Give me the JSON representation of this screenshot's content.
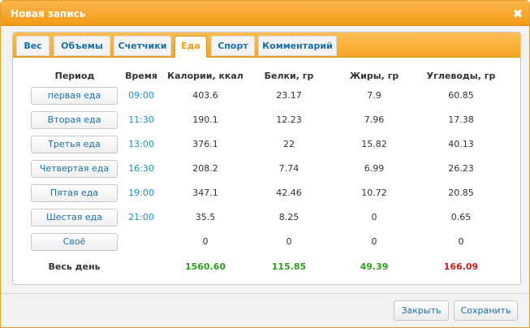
{
  "dialog": {
    "title": "Новая запись",
    "close_icon": "close-icon"
  },
  "tabs": [
    {
      "label": "Вес",
      "active": false
    },
    {
      "label": "Объемы",
      "active": false
    },
    {
      "label": "Счетчики",
      "active": false
    },
    {
      "label": "Еда",
      "active": true
    },
    {
      "label": "Спорт",
      "active": false
    },
    {
      "label": "Комментарий",
      "active": false
    }
  ],
  "table": {
    "headers": {
      "period": "Период",
      "time": "Время",
      "calories": "Калории, ккал",
      "proteins": "Белки, гр",
      "fats": "Жиры, гр",
      "carbs": "Углеводы, гр"
    },
    "rows": [
      {
        "period": "первая еда",
        "time": "09:00",
        "calories": "403.6",
        "proteins": "23.17",
        "fats": "7.9",
        "carbs": "60.85"
      },
      {
        "period": "Вторая еда",
        "time": "11:30",
        "calories": "190.1",
        "proteins": "12.23",
        "fats": "7.96",
        "carbs": "17.38"
      },
      {
        "period": "Третья еда",
        "time": "13:00",
        "calories": "376.1",
        "proteins": "22",
        "fats": "15.82",
        "carbs": "40.13"
      },
      {
        "period": "Четвертая еда",
        "time": "16:30",
        "calories": "208.2",
        "proteins": "7.74",
        "fats": "6.99",
        "carbs": "26.23"
      },
      {
        "period": "Пятая еда",
        "time": "19:00",
        "calories": "347.1",
        "proteins": "42.46",
        "fats": "10.72",
        "carbs": "20.85"
      },
      {
        "period": "Шестая еда",
        "time": "21:00",
        "calories": "35.5",
        "proteins": "8.25",
        "fats": "0",
        "carbs": "0.65"
      },
      {
        "period": "Своё",
        "time": "",
        "calories": "0",
        "proteins": "0",
        "fats": "0",
        "carbs": "0"
      }
    ],
    "total": {
      "label": "Весь день",
      "calories": "1560.60",
      "proteins": "115.85",
      "fats": "49.39",
      "carbs": "166.09"
    },
    "total_colors": {
      "calories": "#2e9e1f",
      "proteins": "#2e9e1f",
      "fats": "#2e9e1f",
      "carbs": "#cc1d1d"
    }
  },
  "footer": {
    "close_label": "Закрыть",
    "save_label": "Сохранить"
  }
}
